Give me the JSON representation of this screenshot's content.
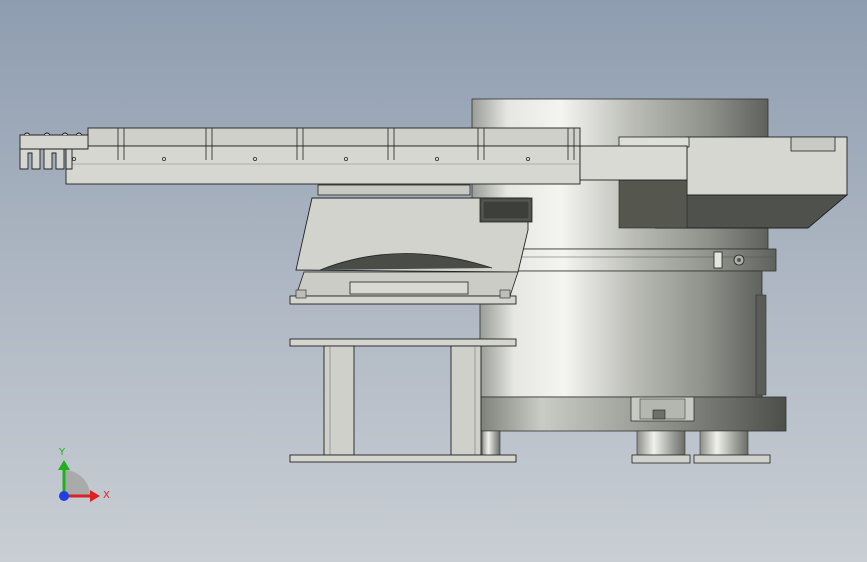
{
  "viewport": {
    "background_top": "#8e9db0",
    "background_bottom": "#c9ced4"
  },
  "model": {
    "metal_color": "#d4d6cf",
    "edge_color": "#222222",
    "shadow_color": "#4a4c48"
  },
  "triad": {
    "x_label": "X",
    "y_label": "Y",
    "x_color": "#e02020",
    "y_color": "#20b020",
    "z_color": "#2040e0"
  }
}
